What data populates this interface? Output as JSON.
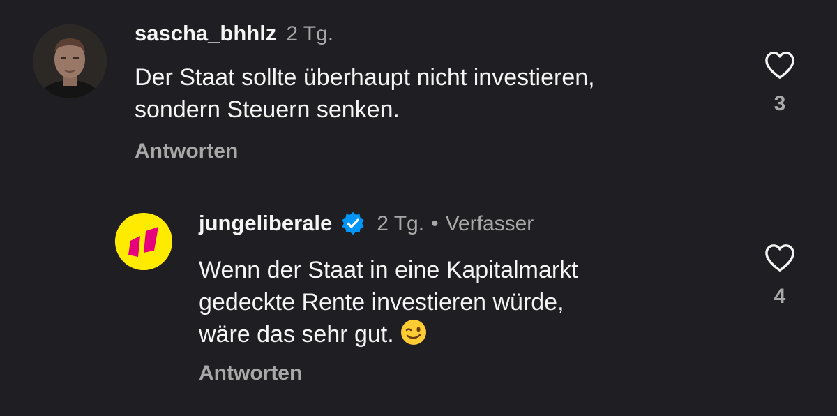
{
  "comments": [
    {
      "username": "sascha_bhhlz",
      "time": "2 Tg.",
      "text_lines": [
        "Der Staat sollte überhaupt nicht investieren,",
        "sondern Steuern senken."
      ],
      "reply_label": "Antworten",
      "like_count": "3",
      "avatar": "profile-photo"
    },
    {
      "username": "jungeliberale",
      "verified": true,
      "time": "2 Tg.",
      "separator": "•",
      "author_label": "Verfasser",
      "text_lines": [
        "Wenn der Staat in eine Kapitalmarkt",
        "gedeckte Rente investieren würde,",
        "wäre das sehr gut."
      ],
      "emoji": "winking-face-emoji",
      "reply_label": "Antworten",
      "like_count": "4",
      "avatar": "jungeliberale-logo"
    }
  ],
  "colors": {
    "background": "#1f1f23",
    "primary_text": "#f5f5f5",
    "secondary_text": "#a8a8a8",
    "verified_blue": "#0095f6",
    "logo_yellow": "#ffeb00",
    "logo_magenta": "#e6007e"
  }
}
